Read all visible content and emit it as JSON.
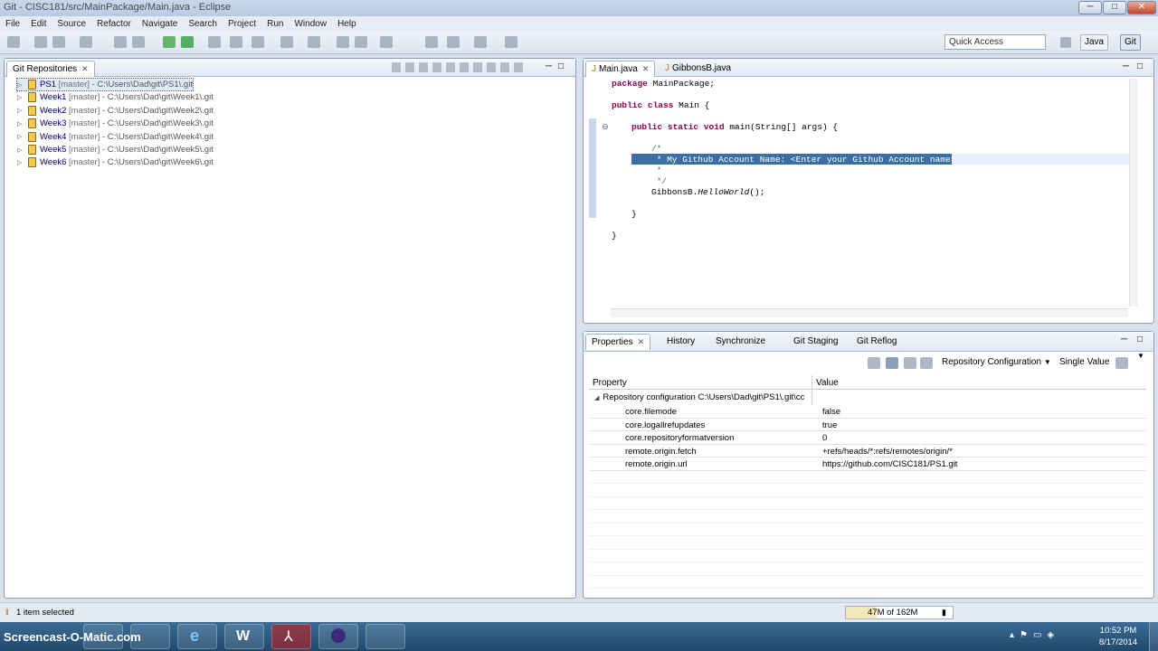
{
  "window": {
    "title": "Git - CISC181/src/MainPackage/Main.java - Eclipse",
    "min_label": "─",
    "max_label": "□",
    "close_label": "✕"
  },
  "menu": [
    "File",
    "Edit",
    "Source",
    "Refactor",
    "Navigate",
    "Search",
    "Project",
    "Run",
    "Window",
    "Help"
  ],
  "toolbar": {
    "quick_access_placeholder": "Quick Access",
    "perspective_java": "Java",
    "perspective_git": "Git"
  },
  "git_repositories": {
    "tab_label": "Git Repositories",
    "repos": [
      {
        "name": "PS1",
        "branch": "[master]",
        "path": "- C:\\Users\\Dad\\git\\PS1\\.git",
        "selected": true
      },
      {
        "name": "Week1",
        "branch": "[master]",
        "path": "- C:\\Users\\Dad\\git\\Week1\\.git"
      },
      {
        "name": "Week2",
        "branch": "[master]",
        "path": "- C:\\Users\\Dad\\git\\Week2\\.git"
      },
      {
        "name": "Week3",
        "branch": "[master]",
        "path": "- C:\\Users\\Dad\\git\\Week3\\.git"
      },
      {
        "name": "Week4",
        "branch": "[master]",
        "path": "- C:\\Users\\Dad\\git\\Week4\\.git"
      },
      {
        "name": "Week5",
        "branch": "[master]",
        "path": "- C:\\Users\\Dad\\git\\Week5\\.git"
      },
      {
        "name": "Week6",
        "branch": "[master]",
        "path": "- C:\\Users\\Dad\\git\\Week6\\.git"
      }
    ]
  },
  "editor": {
    "tabs": [
      {
        "label": "Main.java",
        "active": true
      },
      {
        "label": "GibbonsB.java",
        "active": false
      }
    ],
    "lines": [
      {
        "kind": "plain",
        "kw": "package",
        "rest": " MainPackage;"
      },
      {
        "kind": "plain",
        "kw": "public class",
        "rest": " Main {"
      },
      {
        "kind": "plain",
        "kw": "public static void",
        "rest": " main(String[] args) {"
      },
      {
        "kind": "comment",
        "text": "/*"
      },
      {
        "kind": "selected",
        "text": " * My Github Account Name: <Enter your Github Account name>"
      },
      {
        "kind": "comment",
        "text": " *"
      },
      {
        "kind": "comment",
        "text": " */"
      },
      {
        "kind": "call",
        "text": "GibbonsB.",
        "method": "HelloWorld",
        "tail": "();"
      },
      {
        "kind": "brace",
        "text": "}"
      },
      {
        "kind": "brace",
        "text": "}"
      }
    ]
  },
  "bottom_panel": {
    "tabs": [
      "Properties",
      "History",
      "Synchronize",
      "Git Staging",
      "Git Reflog"
    ],
    "config_dropdown": "Repository Configuration",
    "value_dropdown": "Single Value",
    "columns": {
      "property": "Property",
      "value": "Value"
    },
    "group_label": "Repository configuration C:\\Users\\Dad\\git\\PS1\\.git\\cc",
    "rows": [
      {
        "key": "core.filemode",
        "value": "false"
      },
      {
        "key": "core.logallrefupdates",
        "value": "true"
      },
      {
        "key": "core.repositoryformatversion",
        "value": "0"
      },
      {
        "key": "remote.origin.fetch",
        "value": "+refs/heads/*:refs/remotes/origin/*"
      },
      {
        "key": "remote.origin.url",
        "value": "https://github.com/CISC181/PS1.git"
      }
    ]
  },
  "status": {
    "selection": "1 item selected",
    "heap": "47M of 162M"
  },
  "taskbar": {
    "watermark": "Screencast-O-Matic.com",
    "time": "10:52 PM",
    "date": "8/17/2014"
  }
}
